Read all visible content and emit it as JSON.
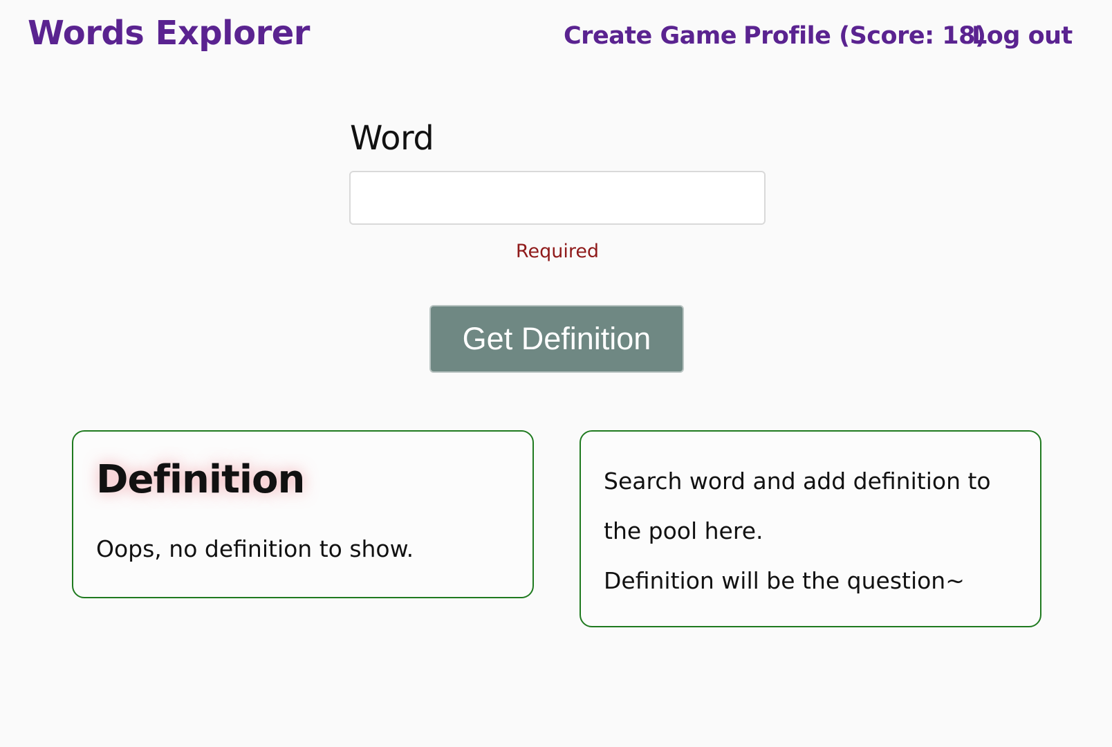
{
  "header": {
    "brand": "Words Explorer",
    "nav": {
      "create_game": "Create Game",
      "profile": "Profile (Score: 18)",
      "logout": "Log out"
    }
  },
  "form": {
    "word_label": "Word",
    "word_value": "",
    "validation_message": "Required",
    "submit_label": "Get Definition"
  },
  "definition_card": {
    "title": "Definition",
    "text": "Oops, no definition to show."
  },
  "info_card": {
    "lines": [
      "Search word and add definition to",
      "the pool here.",
      "Definition will be the question~"
    ]
  },
  "colors": {
    "brand": "#5a2390",
    "button_bg": "#6f8883",
    "card_border": "#1f7a1f",
    "error": "#8f1a1a"
  }
}
